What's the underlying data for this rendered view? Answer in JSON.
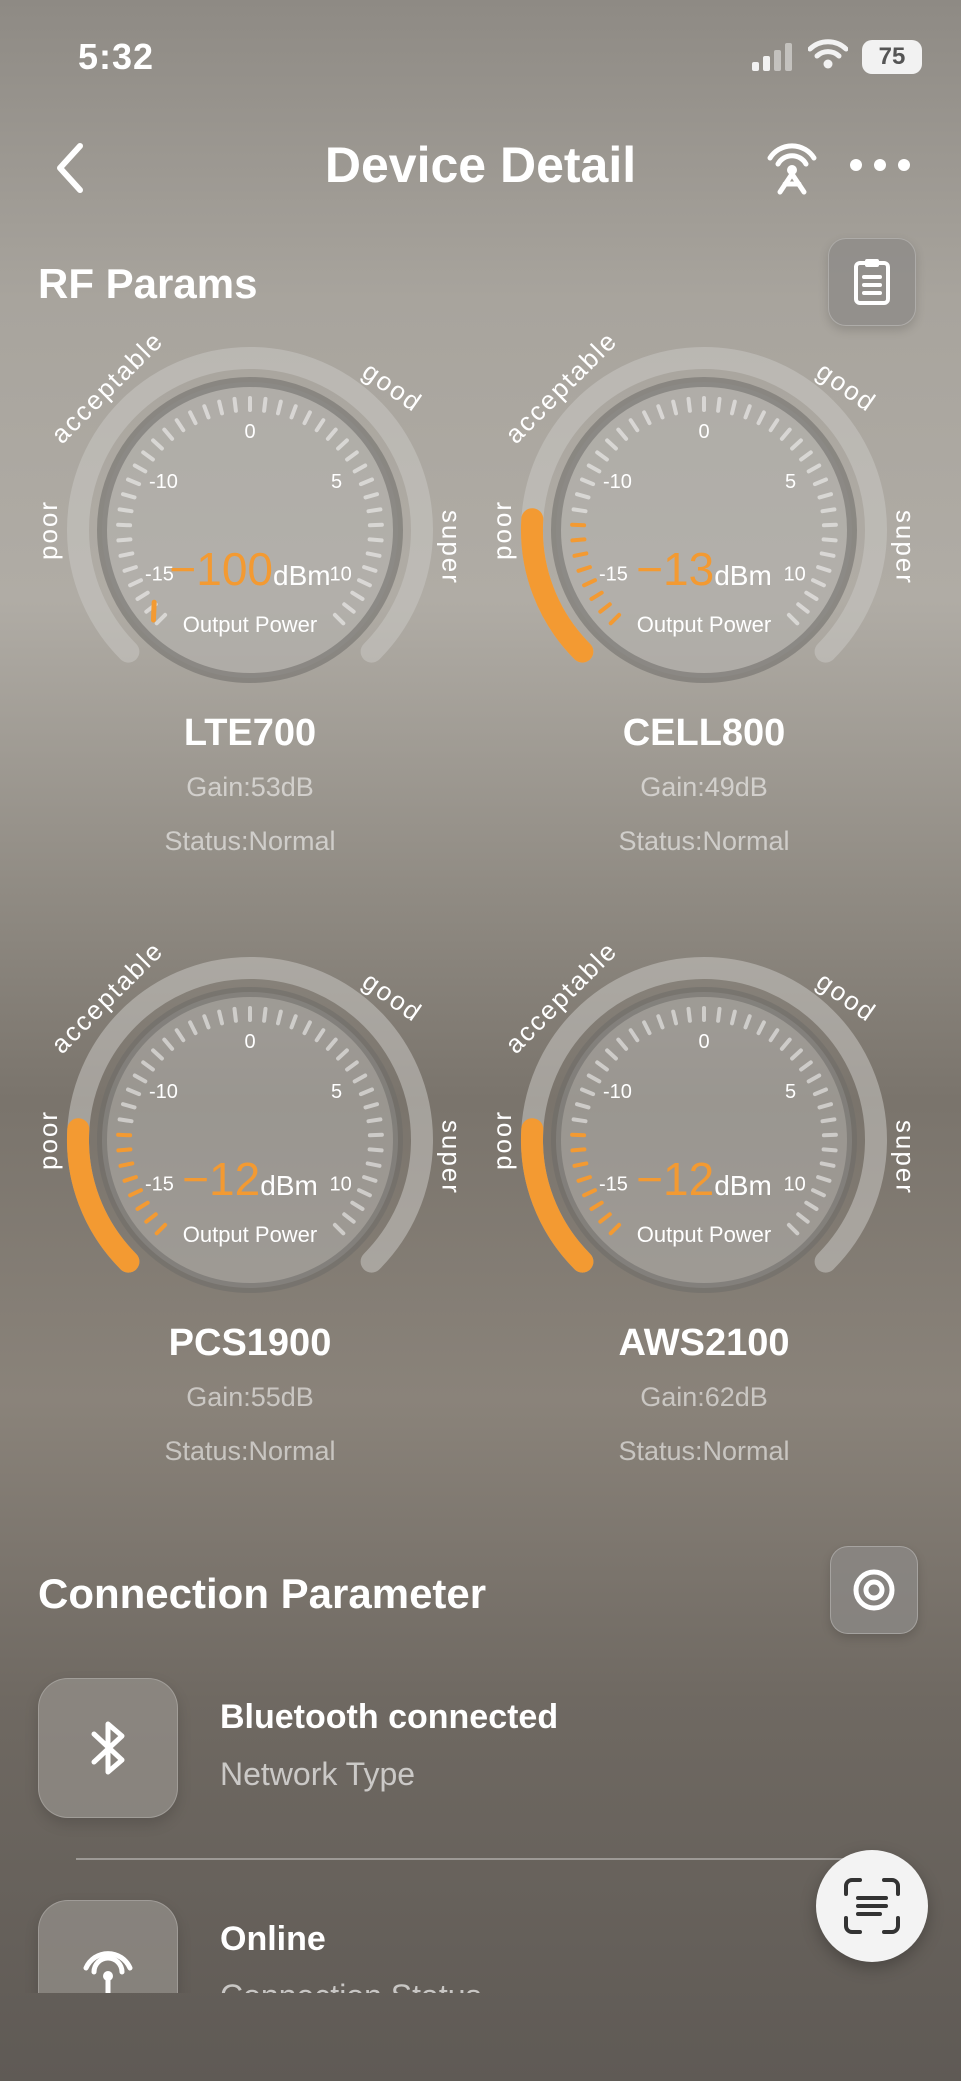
{
  "status_bar": {
    "time": "5:32",
    "battery": "75"
  },
  "nav": {
    "title": "Device Detail"
  },
  "rf_section": {
    "title": "RF Params"
  },
  "gauge_common": {
    "zones": [
      "poor",
      "acceptable",
      "good",
      "super"
    ],
    "ticks": [
      "-15",
      "-10",
      "0",
      "5",
      "10"
    ],
    "unit": "dBm",
    "label": "Output Power"
  },
  "gauges": [
    {
      "name": "LTE700",
      "value": "-100",
      "gain": "Gain:53dB",
      "status": "Status:Normal",
      "fill": 0.0
    },
    {
      "name": "CELL800",
      "value": "-13",
      "gain": "Gain:49dB",
      "status": "Status:Normal",
      "fill": 0.18
    },
    {
      "name": "PCS1900",
      "value": "-12",
      "gain": "Gain:55dB",
      "status": "Status:Normal",
      "fill": 0.18
    },
    {
      "name": "AWS2100",
      "value": "-12",
      "gain": "Gain:62dB",
      "status": "Status:Normal",
      "fill": 0.18
    }
  ],
  "connection": {
    "title": "Connection Parameter",
    "items": [
      {
        "title": "Bluetooth connected",
        "subtitle": "Network Type",
        "icon": "bluetooth-icon"
      },
      {
        "title": "Online",
        "subtitle": "Connection Status",
        "icon": "signal-antenna-icon"
      }
    ]
  },
  "colors": {
    "accent": "#f39a32"
  }
}
